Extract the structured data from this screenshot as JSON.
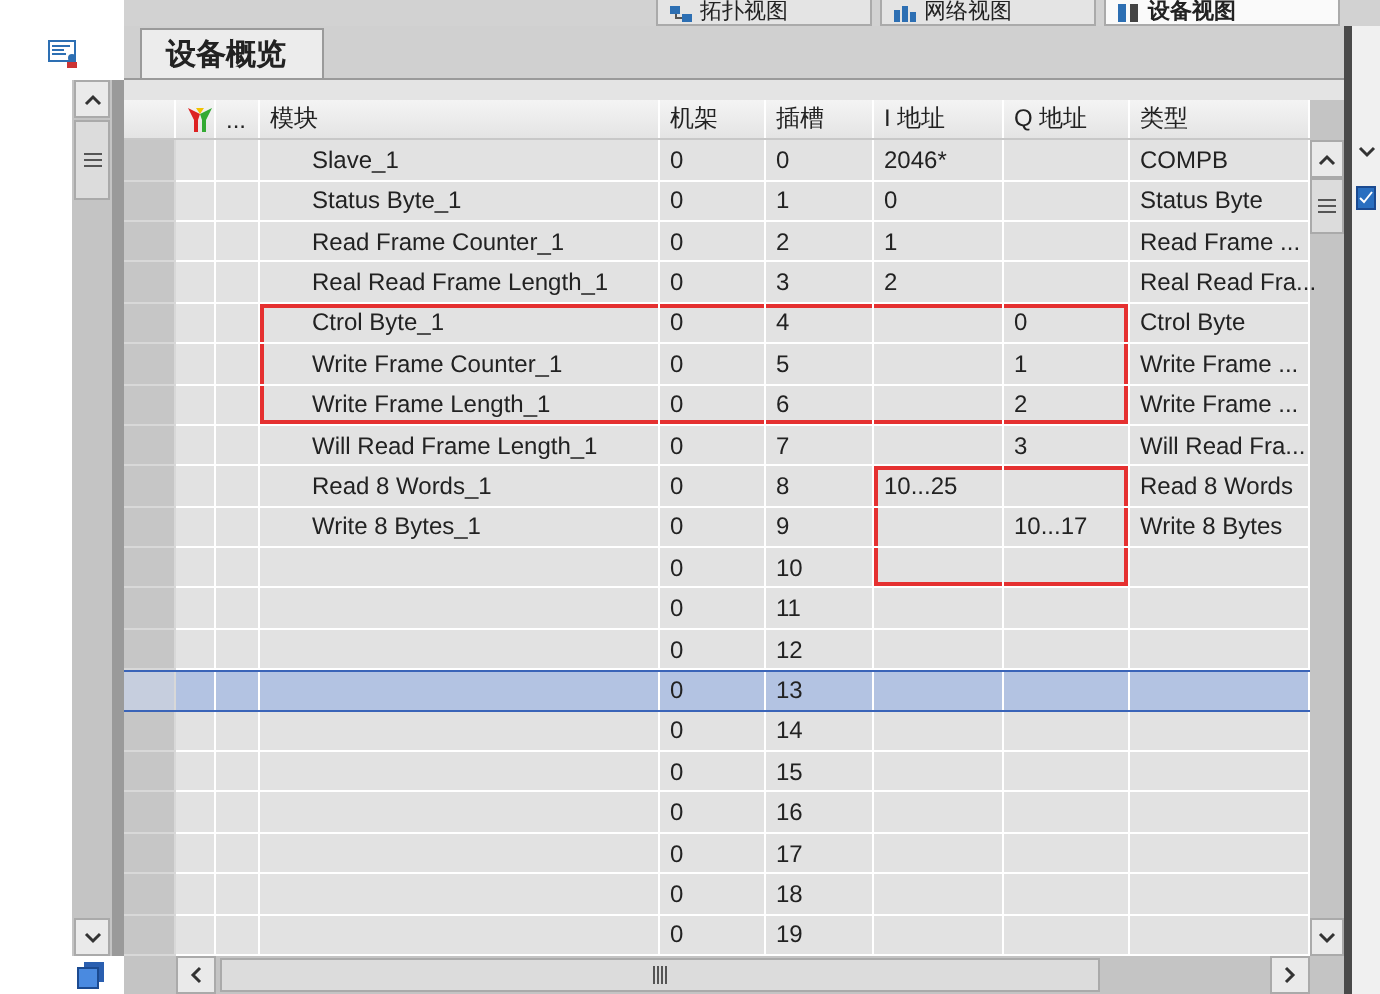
{
  "view_tabs": [
    {
      "label": "拓扑视图",
      "selected": false
    },
    {
      "label": "网络视图",
      "selected": false
    },
    {
      "label": "设备视图",
      "selected": true
    }
  ],
  "overview_tab": {
    "label": "设备概览"
  },
  "table": {
    "header_menu": "...",
    "columns": [
      {
        "label": "模块"
      },
      {
        "label": "机架"
      },
      {
        "label": "插槽"
      },
      {
        "label": "I 地址"
      },
      {
        "label": "Q 地址"
      },
      {
        "label": "类型"
      }
    ],
    "rows": [
      {
        "selected": false,
        "cells": [
          {
            "text": "Slave_1",
            "boxed": false
          },
          {
            "text": "0",
            "boxed": false
          },
          {
            "text": "0",
            "boxed": false
          },
          {
            "text": "2046*",
            "boxed": false
          },
          {
            "boxed": false
          },
          {
            "text": "COMPB",
            "boxed": false
          }
        ]
      },
      {
        "selected": false,
        "cells": [
          {
            "text": "Status Byte_1",
            "boxed": false
          },
          {
            "text": "0",
            "boxed": false
          },
          {
            "text": "1",
            "boxed": false
          },
          {
            "text": "0",
            "boxed": false
          },
          {
            "boxed": false
          },
          {
            "text": "Status Byte",
            "boxed": false
          }
        ]
      },
      {
        "selected": false,
        "cells": [
          {
            "text": "Read Frame Counter_1",
            "boxed": false
          },
          {
            "text": "0",
            "boxed": false
          },
          {
            "text": "2",
            "boxed": false
          },
          {
            "text": "1",
            "boxed": false
          },
          {
            "boxed": false
          },
          {
            "text": "Read Frame ...",
            "boxed": false
          }
        ]
      },
      {
        "selected": false,
        "cells": [
          {
            "text": "Real Read Frame Length_1",
            "boxed": false
          },
          {
            "text": "0",
            "boxed": false
          },
          {
            "text": "3",
            "boxed": false
          },
          {
            "text": "2",
            "boxed": false
          },
          {
            "boxed": false
          },
          {
            "text": "Real Read Fra...",
            "boxed": false
          }
        ]
      },
      {
        "selected": false,
        "cells": [
          {
            "text": "Ctrol Byte_1",
            "boxed": true
          },
          {
            "text": "0",
            "boxed": true
          },
          {
            "text": "4",
            "boxed": true
          },
          {
            "boxed": true
          },
          {
            "text": "0",
            "boxed": true
          },
          {
            "text": "Ctrol Byte",
            "boxed": false
          }
        ]
      },
      {
        "selected": false,
        "cells": [
          {
            "text": "Write Frame Counter_1",
            "boxed": true
          },
          {
            "text": "0",
            "boxed": true
          },
          {
            "text": "5",
            "boxed": true
          },
          {
            "boxed": true
          },
          {
            "text": "1",
            "boxed": true
          },
          {
            "text": "Write Frame ...",
            "boxed": false
          }
        ]
      },
      {
        "selected": false,
        "cells": [
          {
            "text": "Write Frame Length_1",
            "boxed": true
          },
          {
            "text": "0",
            "boxed": true
          },
          {
            "text": "6",
            "boxed": true
          },
          {
            "boxed": true
          },
          {
            "text": "2",
            "boxed": true
          },
          {
            "text": "Write Frame ...",
            "boxed": false
          }
        ]
      },
      {
        "selected": false,
        "cells": [
          {
            "text": "Will Read Frame Length_1",
            "boxed": false
          },
          {
            "text": "0",
            "boxed": false
          },
          {
            "text": "7",
            "boxed": false
          },
          {
            "boxed": false
          },
          {
            "text": "3",
            "boxed": false
          },
          {
            "text": "Will Read Fra...",
            "boxed": false
          }
        ]
      },
      {
        "selected": false,
        "cells": [
          {
            "text": "Read 8 Words_1",
            "boxed": false
          },
          {
            "text": "0",
            "boxed": false
          },
          {
            "text": "8",
            "boxed": false
          },
          {
            "text": "10...25",
            "boxed": true
          },
          {
            "boxed": true
          },
          {
            "text": "Read 8 Words",
            "boxed": false
          }
        ]
      },
      {
        "selected": false,
        "cells": [
          {
            "text": "Write 8 Bytes_1",
            "boxed": false
          },
          {
            "text": "0",
            "boxed": false
          },
          {
            "text": "9",
            "boxed": false
          },
          {
            "boxed": true
          },
          {
            "text": "10...17",
            "boxed": true
          },
          {
            "text": "Write 8 Bytes",
            "boxed": false
          }
        ]
      },
      {
        "selected": false,
        "cells": [
          {
            "boxed": false
          },
          {
            "text": "0",
            "boxed": false
          },
          {
            "text": "10",
            "boxed": false
          },
          {
            "boxed": true
          },
          {
            "boxed": true
          },
          {
            "boxed": false
          }
        ]
      },
      {
        "selected": false,
        "cells": [
          {
            "boxed": false
          },
          {
            "text": "0",
            "boxed": false
          },
          {
            "text": "11",
            "boxed": false
          },
          {
            "boxed": false
          },
          {
            "boxed": false
          },
          {
            "boxed": false
          }
        ]
      },
      {
        "selected": false,
        "cells": [
          {
            "boxed": false
          },
          {
            "text": "0",
            "boxed": false
          },
          {
            "text": "12",
            "boxed": false
          },
          {
            "boxed": false
          },
          {
            "boxed": false
          },
          {
            "boxed": false
          }
        ]
      },
      {
        "selected": true,
        "cells": [
          {
            "boxed": false
          },
          {
            "text": "0",
            "boxed": false
          },
          {
            "text": "13",
            "boxed": false
          },
          {
            "boxed": false
          },
          {
            "boxed": false
          },
          {
            "boxed": false
          }
        ]
      },
      {
        "selected": false,
        "cells": [
          {
            "boxed": false
          },
          {
            "text": "0",
            "boxed": false
          },
          {
            "text": "14",
            "boxed": false
          },
          {
            "boxed": false
          },
          {
            "boxed": false
          },
          {
            "boxed": false
          }
        ]
      },
      {
        "selected": false,
        "cells": [
          {
            "boxed": false
          },
          {
            "text": "0",
            "boxed": false
          },
          {
            "text": "15",
            "boxed": false
          },
          {
            "boxed": false
          },
          {
            "boxed": false
          },
          {
            "boxed": false
          }
        ]
      },
      {
        "selected": false,
        "cells": [
          {
            "boxed": false
          },
          {
            "text": "0",
            "boxed": false
          },
          {
            "text": "16",
            "boxed": false
          },
          {
            "boxed": false
          },
          {
            "boxed": false
          },
          {
            "boxed": false
          }
        ]
      },
      {
        "selected": false,
        "cells": [
          {
            "boxed": false
          },
          {
            "text": "0",
            "boxed": false
          },
          {
            "text": "17",
            "boxed": false
          },
          {
            "boxed": false
          },
          {
            "boxed": false
          },
          {
            "boxed": false
          }
        ]
      },
      {
        "selected": false,
        "cells": [
          {
            "boxed": false
          },
          {
            "text": "0",
            "boxed": false
          },
          {
            "text": "18",
            "boxed": false
          },
          {
            "boxed": false
          },
          {
            "boxed": false
          },
          {
            "boxed": false
          }
        ]
      },
      {
        "selected": false,
        "cells": [
          {
            "boxed": false
          },
          {
            "text": "0",
            "boxed": false
          },
          {
            "text": "19",
            "boxed": false
          },
          {
            "boxed": false
          },
          {
            "boxed": false
          },
          {
            "boxed": false
          }
        ]
      }
    ]
  }
}
